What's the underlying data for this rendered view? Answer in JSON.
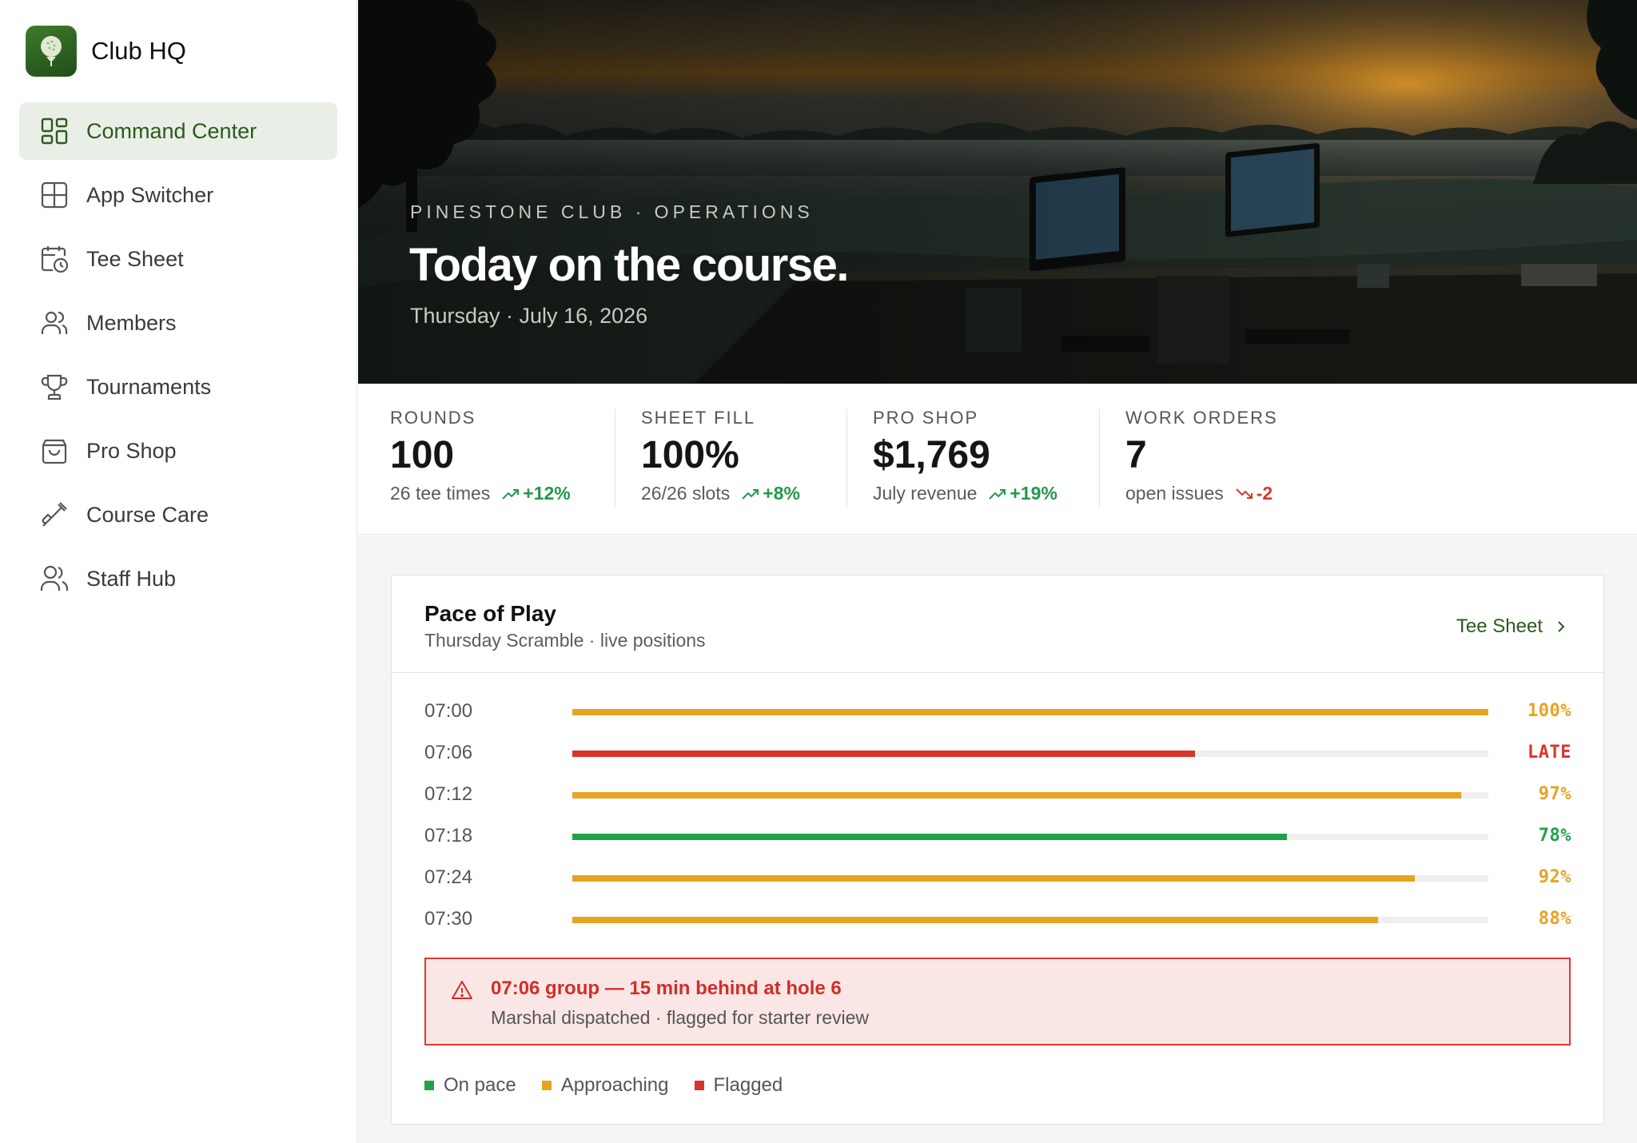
{
  "app": {
    "name": "Club HQ"
  },
  "sidebar": {
    "items": [
      {
        "label": "Command Center",
        "icon": "grid-dashboard-icon",
        "active": true
      },
      {
        "label": "App Switcher",
        "icon": "app-grid-icon"
      },
      {
        "label": "Tee Sheet",
        "icon": "calendar-clock-icon"
      },
      {
        "label": "Members",
        "icon": "users-icon"
      },
      {
        "label": "Tournaments",
        "icon": "trophy-icon"
      },
      {
        "label": "Pro Shop",
        "icon": "shopping-bag-icon"
      },
      {
        "label": "Course Care",
        "icon": "shovel-icon"
      },
      {
        "label": "Staff Hub",
        "icon": "staff-icon"
      }
    ]
  },
  "hero": {
    "eyebrow": "PINESTONE CLUB · OPERATIONS",
    "title": "Today on the course.",
    "date": "Thursday · July 16, 2026"
  },
  "kpis": [
    {
      "label": "ROUNDS",
      "value": "100",
      "sub": "26 tee times",
      "trend": "+12%",
      "direction": "up"
    },
    {
      "label": "SHEET FILL",
      "value": "100%",
      "sub": "26/26 slots",
      "trend": "+8%",
      "direction": "up"
    },
    {
      "label": "PRO SHOP",
      "value": "$1,769",
      "sub": "July revenue",
      "trend": "+19%",
      "direction": "up"
    },
    {
      "label": "WORK ORDERS",
      "value": "7",
      "sub": "open issues",
      "trend": "-2",
      "direction": "down"
    }
  ],
  "pace": {
    "title": "Pace of Play",
    "subtitle": "Thursday Scramble · live positions",
    "link_label": "Tee Sheet",
    "rows": [
      {
        "time": "07:00",
        "progress": 1.0,
        "label": "100%",
        "status": "approaching"
      },
      {
        "time": "07:06",
        "progress": 0.68,
        "label": "LATE",
        "status": "flagged"
      },
      {
        "time": "07:12",
        "progress": 0.97,
        "label": "97%",
        "status": "approaching"
      },
      {
        "time": "07:18",
        "progress": 0.78,
        "label": "78%",
        "status": "on-pace"
      },
      {
        "time": "07:24",
        "progress": 0.92,
        "label": "92%",
        "status": "approaching"
      },
      {
        "time": "07:30",
        "progress": 0.88,
        "label": "88%",
        "status": "approaching"
      }
    ],
    "alert": {
      "title": "07:06 group — 15 min behind at hole 6",
      "detail": "Marshal dispatched · flagged for starter review"
    },
    "legend": [
      {
        "label": "On pace",
        "status": "on-pace"
      },
      {
        "label": "Approaching",
        "status": "approaching"
      },
      {
        "label": "Flagged",
        "status": "flagged"
      }
    ]
  },
  "colors": {
    "brand": "#2b5a1e",
    "on-pace": "#22a04b",
    "approaching": "#e8a321",
    "flagged": "#d9342b",
    "trend_up": "#22994a",
    "trend_down": "#d23a2b"
  }
}
